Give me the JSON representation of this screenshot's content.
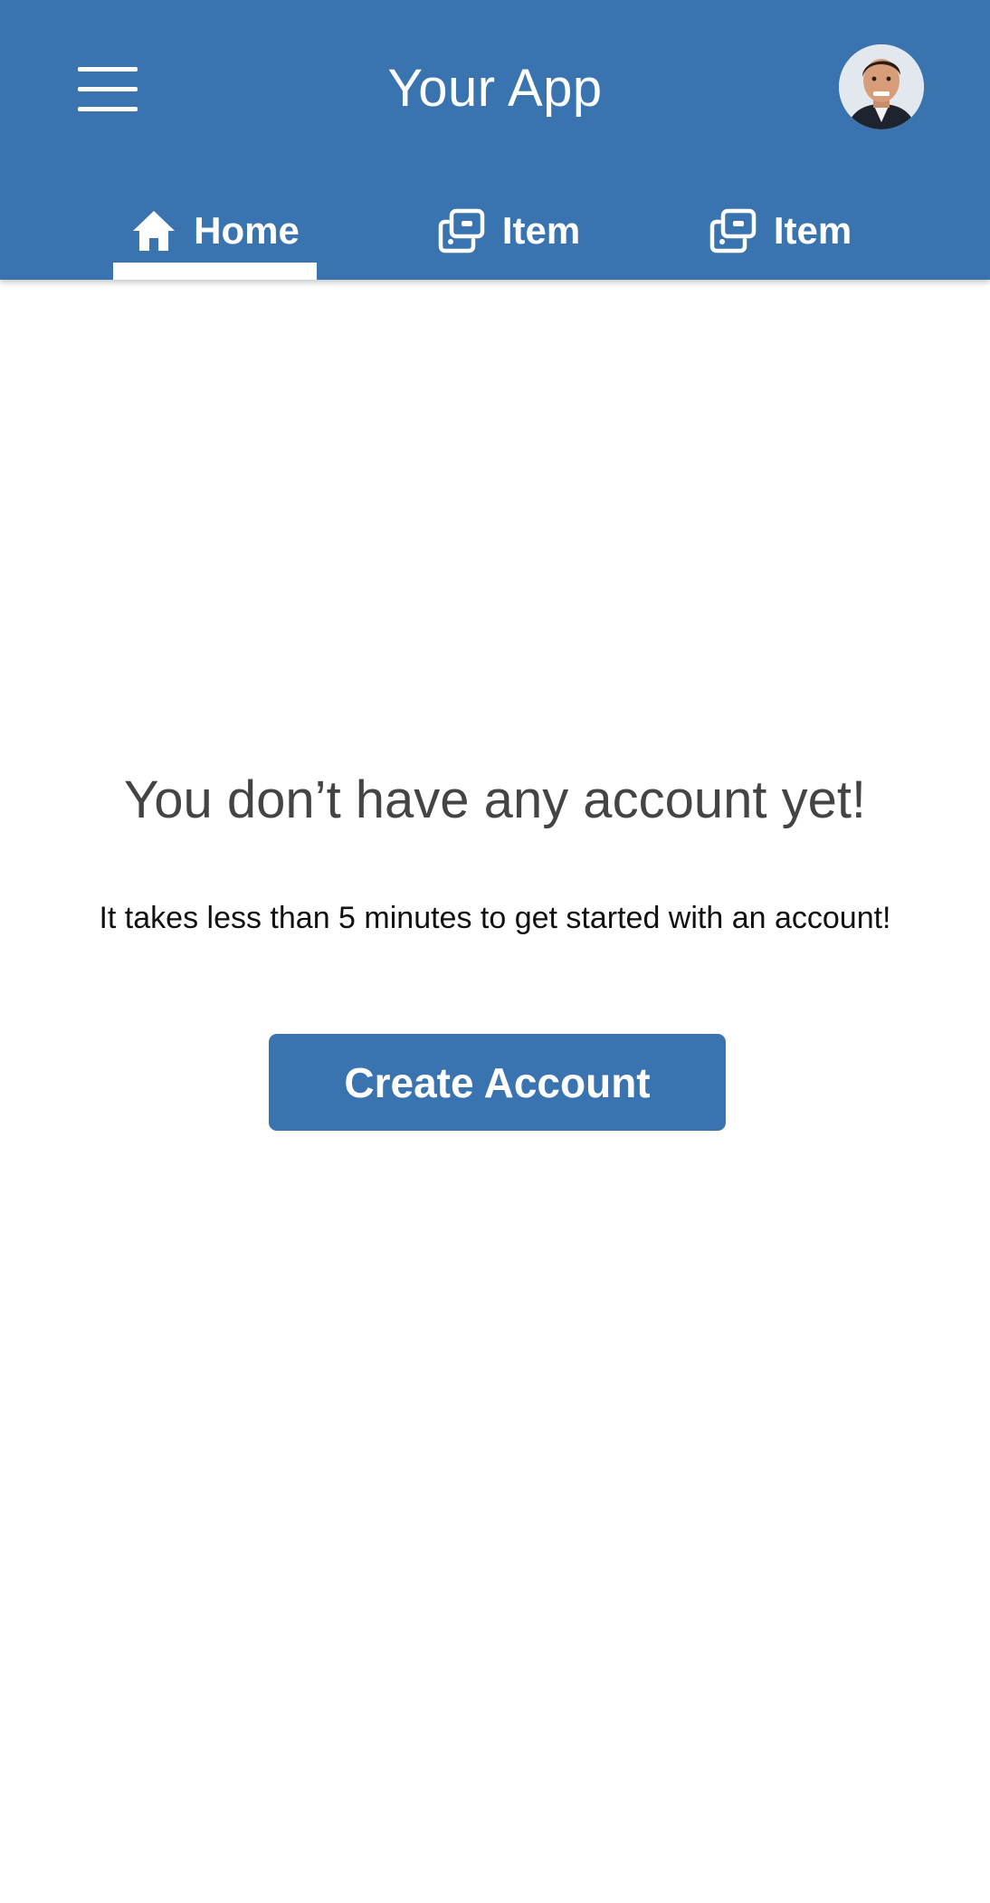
{
  "header": {
    "title": "Your App",
    "menu_icon": "hamburger-menu-icon",
    "avatar_icon": "user-avatar"
  },
  "tabs": [
    {
      "label": "Home",
      "icon": "home-icon",
      "active": true
    },
    {
      "label": "Item",
      "icon": "item-cards-icon",
      "active": false
    },
    {
      "label": "Item",
      "icon": "item-cards-icon",
      "active": false
    }
  ],
  "empty_state": {
    "headline": "You don’t have any account yet!",
    "subtext": "It takes less than 5 minutes to get started with an account!",
    "button_label": "Create Account"
  },
  "colors": {
    "primary": "#3974b1",
    "background": "#ffffff",
    "headline_text": "#444444",
    "body_text": "#111111"
  }
}
